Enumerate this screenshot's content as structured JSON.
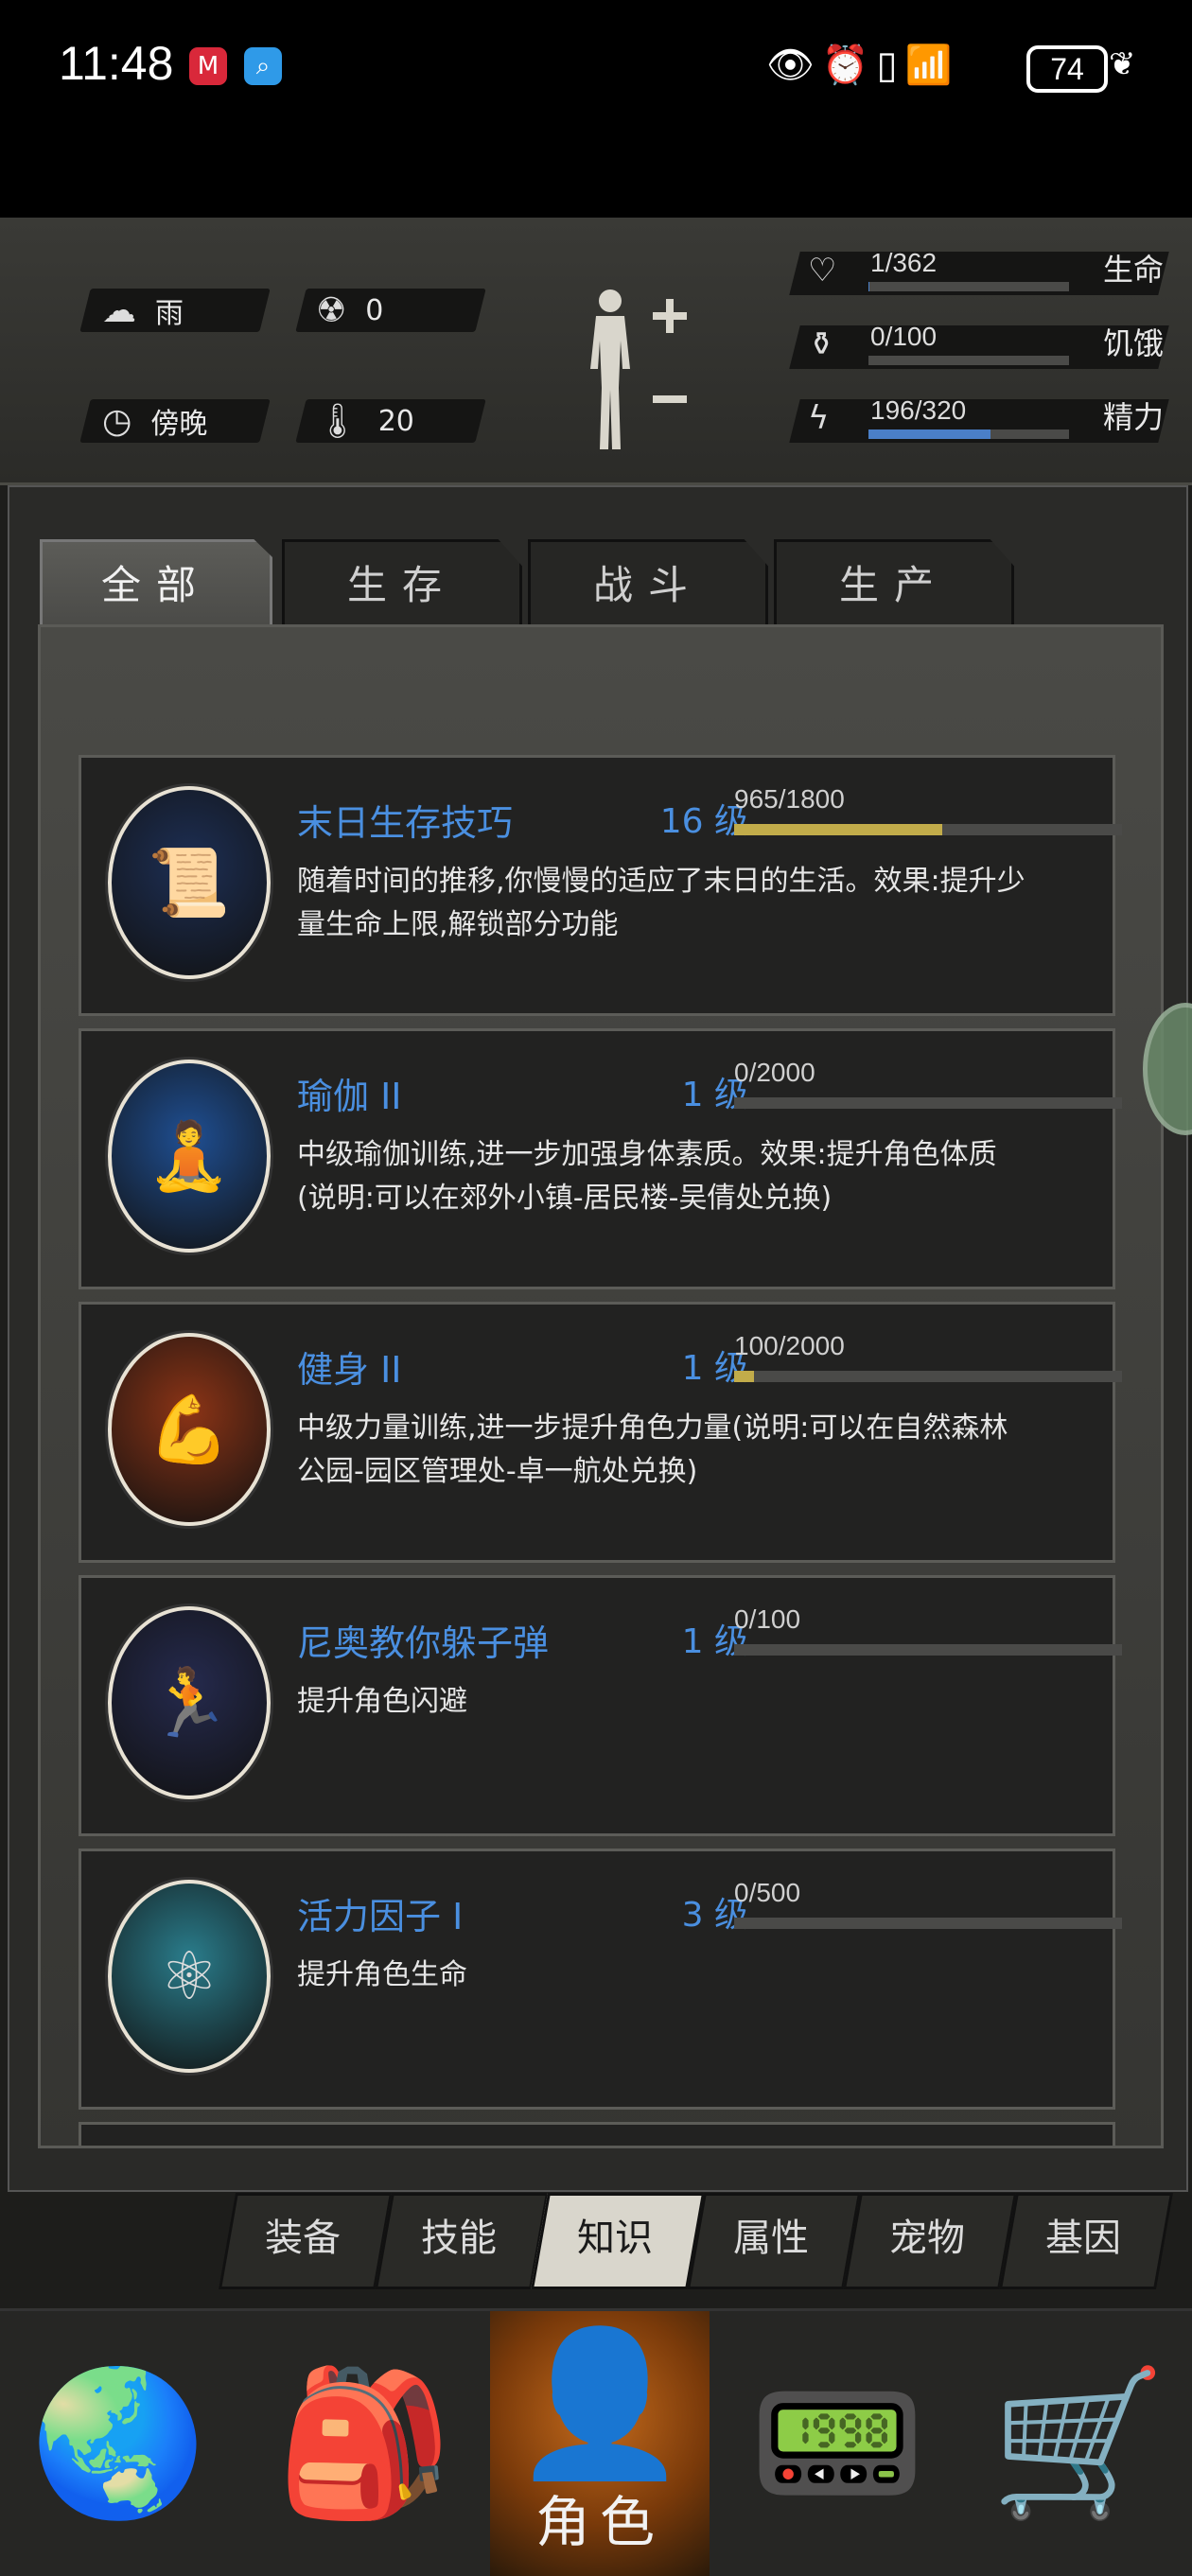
{
  "status_bar": {
    "time": "11:48",
    "battery": "74"
  },
  "hud": {
    "weather": "雨",
    "radiation": "0",
    "time_of_day": "傍晚",
    "temperature": "20",
    "stats": [
      {
        "value": "1/362",
        "label": "生命",
        "icon": "heart-pulse-icon",
        "fill": 0.003
      },
      {
        "value": "0/100",
        "label": "饥饿",
        "icon": "stomach-icon",
        "fill": 0
      },
      {
        "value": "196/320",
        "label": "精力",
        "icon": "energy-icon",
        "fill": 0.61
      }
    ]
  },
  "tabs": [
    "全部",
    "生存",
    "战斗",
    "生产"
  ],
  "active_tab": "全部",
  "knowledge": [
    {
      "name": "末日生存技巧",
      "level": "16 级",
      "progress": "965/1800",
      "fill": 0.536,
      "desc": "随着时间的推移,你慢慢的适应了末日的生活。效果:提升少量生命上限,解锁部分功能",
      "icon": "scroll-icon",
      "bg": "#1d2f55"
    },
    {
      "name": "瑜伽 II",
      "level": "1 级",
      "progress": "0/2000",
      "fill": 0,
      "desc": "中级瑜伽训练,进一步加强身体素质。效果:提升角色体质(说明:可以在郊外小镇-居民楼-吴倩处兑换)",
      "icon": "yoga-icon",
      "bg": "#1f4f93"
    },
    {
      "name": "健身 II",
      "level": "1 级",
      "progress": "100/2000",
      "fill": 0.05,
      "desc": "中级力量训练,进一步提升角色力量(说明:可以在自然森林公园-园区管理处-卓一航处兑换)",
      "icon": "muscle-icon",
      "bg": "#8c3416"
    },
    {
      "name": "尼奥教你躲子弹",
      "level": "1 级",
      "progress": "0/100",
      "fill": 0,
      "desc": "提升角色闪避",
      "icon": "dodge-icon",
      "bg": "#252a4e"
    },
    {
      "name": "活力因子 I",
      "level": "3 级",
      "progress": "0/500",
      "fill": 0,
      "desc": "提升角色生命",
      "icon": "molecule-icon",
      "bg": "#2a7d8c"
    }
  ],
  "sub_tabs": [
    "装备",
    "技能",
    "知识",
    "属性",
    "宠物",
    "基因"
  ],
  "active_sub_tab": "知识",
  "bottom_nav": {
    "role_label": "角色"
  },
  "colors": {
    "accent_blue": "#4a8fe0",
    "progress_gold": "#c2ac4a",
    "energy_blue": "#4a7fc8",
    "role_orange": "#c36a1c"
  }
}
